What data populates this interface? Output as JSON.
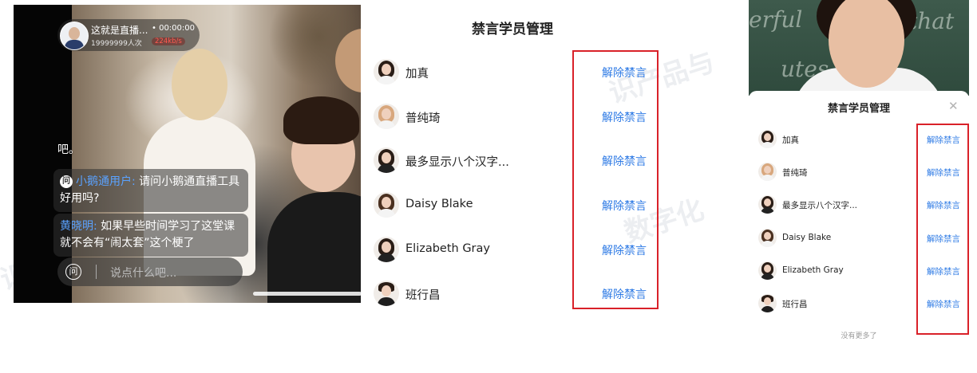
{
  "stream": {
    "host": {
      "title": "这就是直播...",
      "time": "• 00:00:00",
      "views": "19999999人次",
      "speed": "224kb/s"
    },
    "chat": {
      "line_partial": "吧。",
      "q_badge": "问",
      "msg1_name": "小鹅通用户:",
      "msg1_text": "请问小鹅通直播工具好用吗?",
      "msg2_name": "黄晓明:",
      "msg2_text": "如果早些时间学习了这堂课就不会有“闹太套”这个梗了"
    },
    "input": {
      "q_icon": "问",
      "placeholder": "说点什么吧..."
    }
  },
  "middle": {
    "title": "禁言学员管理",
    "rows": [
      {
        "name": "加真",
        "action": "解除禁言"
      },
      {
        "name": "普纯琦",
        "action": "解除禁言"
      },
      {
        "name": "最多显示八个汉字...",
        "action": "解除禁言"
      },
      {
        "name": "Daisy Blake",
        "action": "解除禁言"
      },
      {
        "name": "Elizabeth Gray",
        "action": "解除禁言"
      },
      {
        "name": "班行昌",
        "action": "解除禁言"
      }
    ]
  },
  "right": {
    "title": "禁言学员管理",
    "close": "✕",
    "rows": [
      {
        "name": "加真",
        "action": "解除禁言"
      },
      {
        "name": "普纯琦",
        "action": "解除禁言"
      },
      {
        "name": "最多显示八个汉字...",
        "action": "解除禁言"
      },
      {
        "name": "Daisy Blake",
        "action": "解除禁言"
      },
      {
        "name": "Elizabeth Gray",
        "action": "解除禁言"
      },
      {
        "name": "班行昌",
        "action": "解除禁言"
      }
    ],
    "footer": "没有更多了"
  },
  "colors": {
    "accent": "#2f7be5",
    "highlight": "#d92129",
    "speed": "#ff5a50"
  }
}
